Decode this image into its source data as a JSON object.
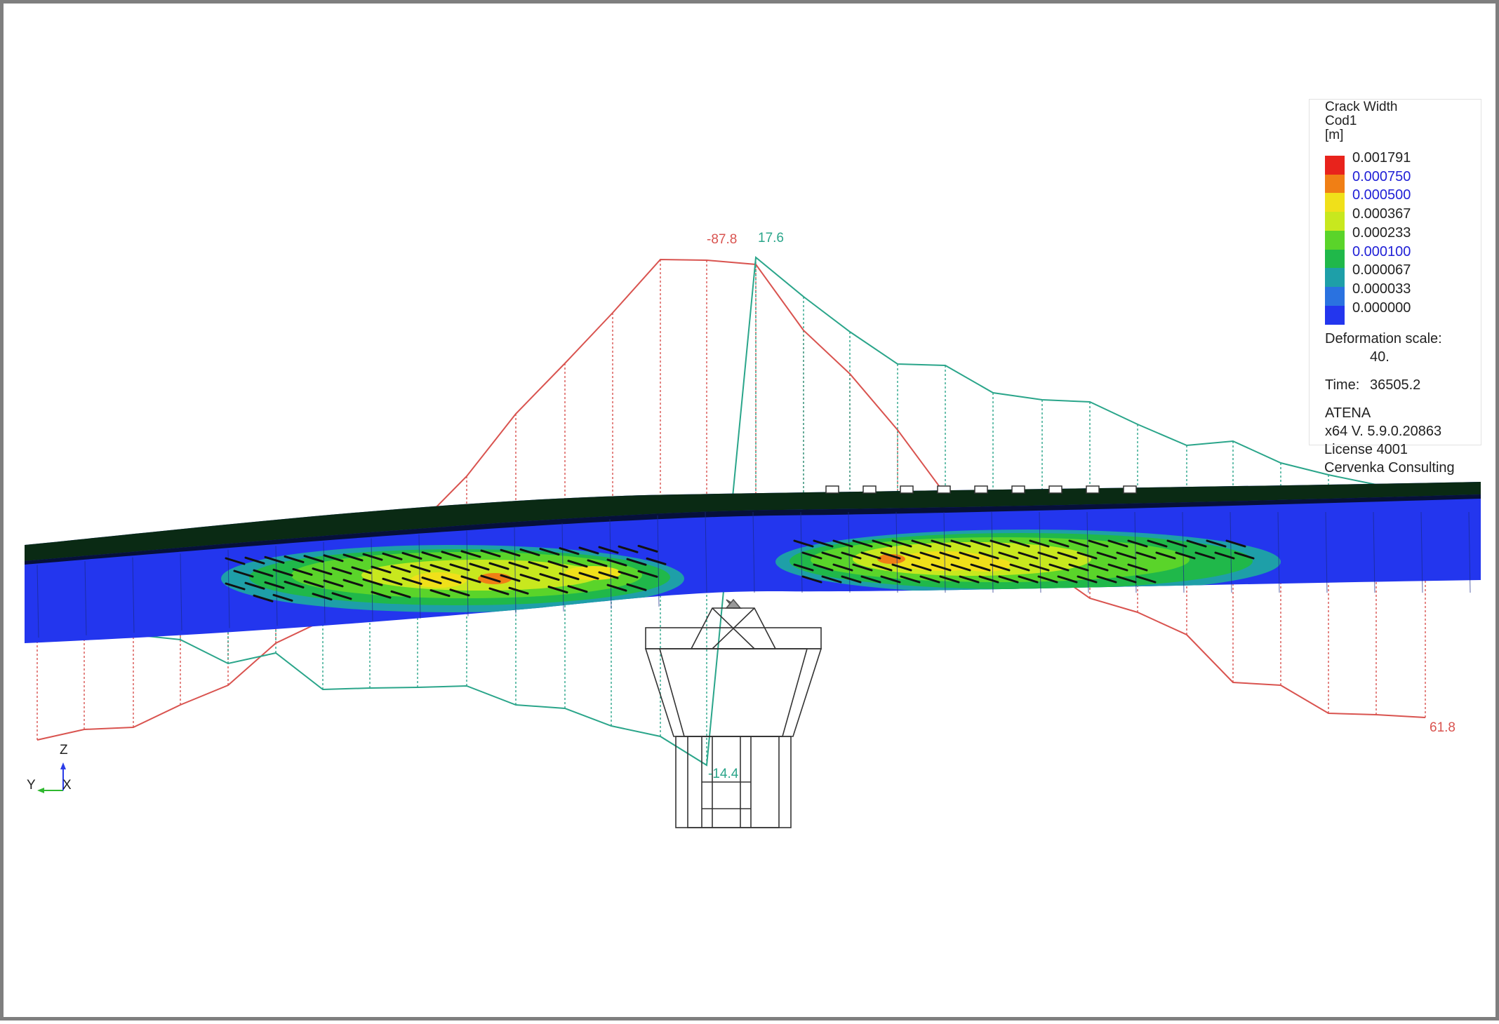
{
  "legend": {
    "title_lines": [
      "Crack Width",
      "Cod1",
      "[m]"
    ],
    "scale": [
      {
        "value": "0.001791",
        "color": "#e8231c",
        "highlight": false
      },
      {
        "value": "0.000750",
        "color": "#f07f15",
        "highlight": true
      },
      {
        "value": "0.000500",
        "color": "#f0e01a",
        "highlight": true
      },
      {
        "value": "0.000367",
        "color": "#c8e81e",
        "highlight": false
      },
      {
        "value": "0.000233",
        "color": "#5ad42a",
        "highlight": false
      },
      {
        "value": "0.000100",
        "color": "#20b84a",
        "highlight": true
      },
      {
        "value": "0.000067",
        "color": "#1e9fa8",
        "highlight": false
      },
      {
        "value": "0.000033",
        "color": "#2a72e0",
        "highlight": false
      },
      {
        "value": "0.000000",
        "color": "#2336ee",
        "highlight": false
      }
    ],
    "deformation_label": "Deformation scale:",
    "deformation_value": "40.",
    "time_label": "Time:",
    "time_value": "36505.2",
    "software_lines": [
      "ATENA",
      "x64 V. 5.9.0.20863",
      "License 4001",
      "Cervenka Consulting"
    ]
  },
  "diagram_labels": {
    "red_peak": "-87.8",
    "teal_peak": "17.6",
    "teal_min": "-14.4",
    "red_end": "61.8"
  },
  "axes": {
    "z": "Z",
    "y": "Y",
    "x": "X"
  },
  "colors": {
    "red_curve": "#d9534f",
    "teal_curve": "#2aa58a",
    "deck_top": "#0a2a14",
    "deck_base": "#2336ee"
  }
}
